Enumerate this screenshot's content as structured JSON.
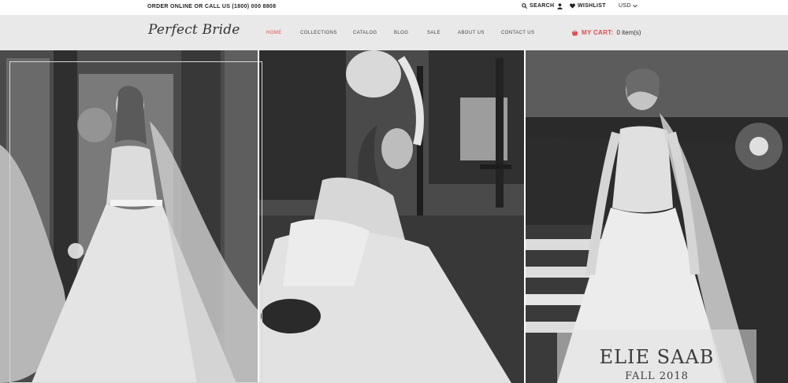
{
  "topbar": {
    "promo": "ORDER ONLINE OR CALL US (1800) 000 8808",
    "search_label": "SEARCH",
    "wishlist_label": "WISHLIST",
    "currency": "USD"
  },
  "header": {
    "logo": "Perfect Bride",
    "nav": [
      "HOME",
      "COLLECTIONS",
      "CATALOG",
      "BLOG",
      "SALE",
      "ABOUT US",
      "CONTACT US"
    ],
    "active_nav": "HOME",
    "cart_label": "MY CART:",
    "cart_count": "0 item(s)"
  },
  "hero": {
    "caption_title": "ELIE SAAB",
    "caption_subtitle": "FALL 2018"
  },
  "colors": {
    "accent": "#e14b4b",
    "header_bg": "#e9e9e9"
  },
  "icons": [
    "search-icon",
    "user-icon",
    "heart-icon",
    "chevron-down-icon",
    "cart-icon"
  ]
}
